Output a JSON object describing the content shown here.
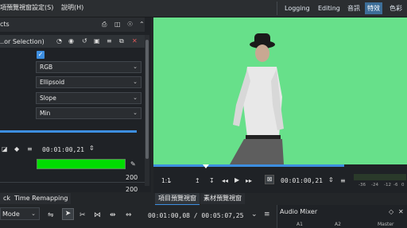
{
  "menubar": {
    "items": [
      "項預覽視窗",
      "設定(S)",
      "說明(H)"
    ],
    "workspaces": [
      "Logging",
      "Editing",
      "音訊",
      "特效",
      "色彩"
    ],
    "active_workspace": "特效"
  },
  "effects": {
    "header_label": "cts",
    "effect_name": "..or Selection)",
    "params": [
      "RGB",
      "Ellipsoid",
      "Slope",
      "Min"
    ],
    "checkbox_checked": true,
    "timecode": "00:01:00,21",
    "color_swatch": "#00dd00",
    "value_1": "200",
    "value_2": "200"
  },
  "monitor": {
    "zoom": "1:1",
    "timecode": "00:01:00,21",
    "scale_labels": [
      "-36",
      "-24",
      "-12",
      "-6",
      "0"
    ]
  },
  "tabs": {
    "left": [
      "ck",
      "Time Remapping"
    ],
    "monitor": [
      "項目預覽視窗",
      "素材預覽視窗"
    ],
    "active_monitor": "項目預覽視窗",
    "audio_mixer": "Audio Mixer"
  },
  "bottom": {
    "mode_label": "Mode",
    "timecode": "00:01:00,08 / 00:05:07,25",
    "mixer_channels": [
      "A1",
      "A2",
      "Master"
    ]
  },
  "colors": {
    "accent": "#3d6e98",
    "monitor_bg": "#67e08a"
  }
}
